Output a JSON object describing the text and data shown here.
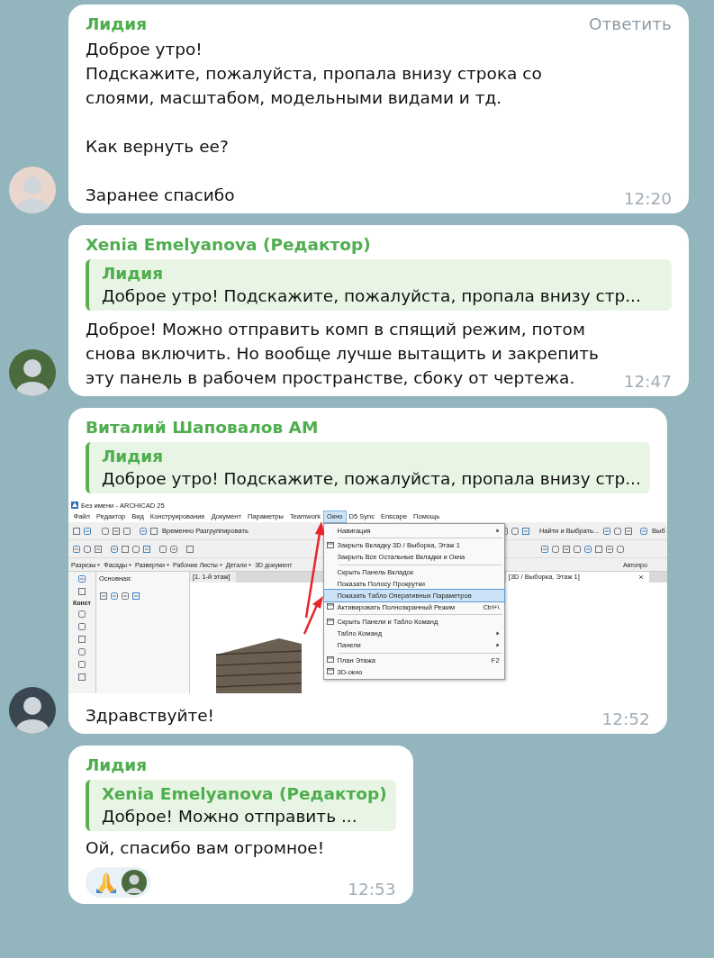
{
  "messages": [
    {
      "sender": "Лидия",
      "reply_action": "Ответить",
      "avatar": true,
      "text": "Доброе утро!\nПодскажите, пожалуйста, пропала внизу строка со слоями, масштабом, модельными видами и тд.\n\nКак вернуть ее?\n\nЗаранее спасибо",
      "time": "12:20",
      "reacted": false
    },
    {
      "sender": "Xenia Emelyanova (Редактор)",
      "avatar": true,
      "quote": {
        "sender": "Лидия",
        "text": "Доброе утро! Подскажите, пожалуйста, пропала внизу стр..."
      },
      "text": "Доброе! Можно отправить комп в спящий режим, потом снова включить. Но вообще лучше вытащить и закрепить эту панель в рабочем пространстве, сбоку от чертежа.",
      "time": "12:47",
      "reacted": false
    },
    {
      "sender": "Виталий Шаповалов АМ",
      "avatar": true,
      "quote": {
        "sender": "Лидия",
        "text": "Доброе утро! Подскажите, пожалуйста, пропала внизу стр..."
      },
      "screenshot": {
        "title": "Без имени - ARCHICAD 25",
        "menu": [
          {
            "label": "Файл",
            "selected": false
          },
          {
            "label": "Редактор",
            "selected": false
          },
          {
            "label": "Вид",
            "selected": false
          },
          {
            "label": "Конструирование",
            "selected": false
          },
          {
            "label": "Документ",
            "selected": false
          },
          {
            "label": "Параметры",
            "selected": false
          },
          {
            "label": "Teamwork",
            "selected": false
          },
          {
            "label": "Окно",
            "selected": true
          },
          {
            "label": "D5 Sync",
            "selected": false
          },
          {
            "label": "Enscape",
            "selected": false
          },
          {
            "label": "Помощь",
            "selected": false
          }
        ],
        "toolbar_button": "Временно Разгруппировать",
        "find_button": "Найти и Выбрать...",
        "cut_button": "Выб",
        "view_buttons": [
          "Разрезы",
          "Фасады",
          "Развертки",
          "Рабочие Листы",
          "Детали",
          "3D документ"
        ],
        "right_label": "Автопро",
        "palette_title": "Основная:",
        "toolbox_label": "Конст",
        "tabs": [
          {
            "label": "[1. 1-й этаж]",
            "selected": false
          },
          {
            "label": "[3D / Выборка, Этаж 1]",
            "selected": true
          }
        ],
        "dropdown": [
          {
            "kind": "item",
            "label": "Навигация",
            "submenu": true,
            "icon": false,
            "selected": false
          },
          {
            "kind": "separator"
          },
          {
            "kind": "item",
            "label": "Закрыть Вкладку 3D / Выборка, Этаж 1",
            "submenu": false,
            "icon": true,
            "selected": false
          },
          {
            "kind": "item",
            "label": "Закрыть Все Остальные Вкладки и Окна",
            "submenu": false,
            "icon": false,
            "selected": false
          },
          {
            "kind": "separator"
          },
          {
            "kind": "item",
            "label": "Скрыть Панель Вкладок",
            "submenu": false,
            "icon": false,
            "selected": false
          },
          {
            "kind": "item",
            "label": "Показать Полосу Прокрутки",
            "submenu": false,
            "icon": false,
            "selected": false
          },
          {
            "kind": "item",
            "label": "Показать Табло Оперативных Параметров",
            "submenu": false,
            "icon": false,
            "selected": true
          },
          {
            "kind": "item",
            "label": "Активировать Полноэкранный Режим",
            "shortcut": "Ctrl+\\",
            "submenu": false,
            "icon": true,
            "selected": false
          },
          {
            "kind": "separator"
          },
          {
            "kind": "item",
            "label": "Скрыть Панели и Табло Команд",
            "submenu": false,
            "icon": true,
            "selected": false
          },
          {
            "kind": "item",
            "label": "Табло Команд",
            "submenu": true,
            "icon": false,
            "selected": false
          },
          {
            "kind": "item",
            "label": "Панели",
            "submenu": true,
            "icon": false,
            "selected": false
          },
          {
            "kind": "separator"
          },
          {
            "kind": "item",
            "label": "План Этажа",
            "shortcut": "F2",
            "submenu": false,
            "icon": true,
            "selected": false
          },
          {
            "kind": "item",
            "label": "3D-окно",
            "submenu": false,
            "icon": true,
            "selected": false
          }
        ]
      },
      "text": "Здравствуйте!",
      "time": "12:52",
      "reacted": false
    },
    {
      "sender": "Лидия",
      "avatar": false,
      "quote": {
        "sender": "Xenia Emelyanova (Редактор)",
        "text": "Доброе! Можно отправить ..."
      },
      "text": "Ой, спасибо вам огромное!",
      "time": "12:53",
      "reacted": true
    }
  ]
}
